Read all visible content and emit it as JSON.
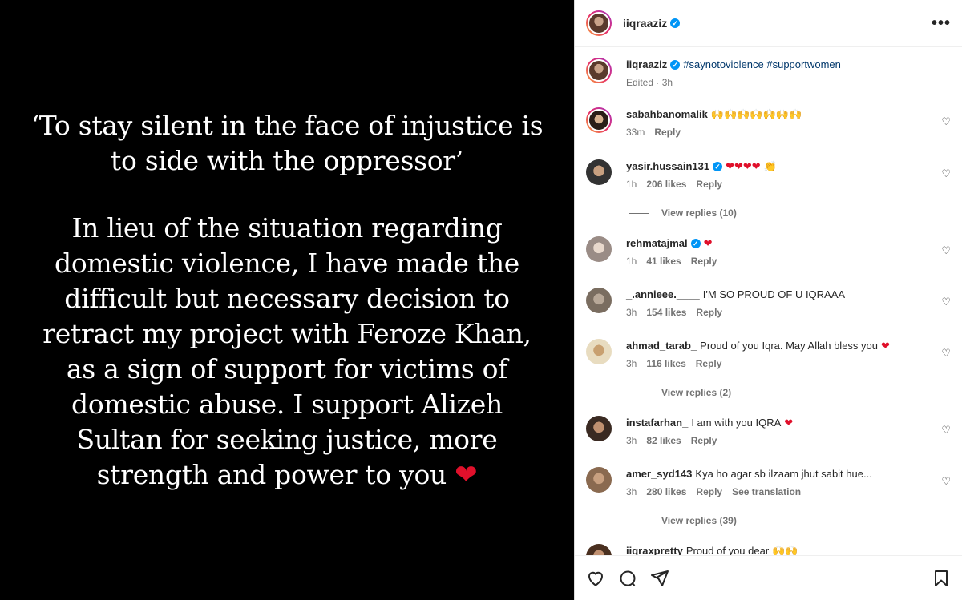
{
  "story": {
    "quote_lines": [
      "‘To stay silent in the face of injustice is",
      "to side with the oppressor’"
    ],
    "body_lines": [
      "In lieu of the situation regarding",
      "domestic violence, I have made the",
      "difficult but necessary decision to",
      "retract my project with Feroze Khan,",
      "as a sign of support for victims of",
      "domestic abuse. I support Alizeh",
      "Sultan for seeking justice, more",
      "strength and power to you"
    ],
    "heart": "❤"
  },
  "header": {
    "username": "iiqraaziz",
    "verified": "✓",
    "more": "•••"
  },
  "caption": {
    "username": "iiqraaziz",
    "text": "#saynotoviolence #supportwomen",
    "meta": "Edited · 3h"
  },
  "comments": [
    {
      "username": "sabahbanomalik",
      "text": "",
      "emoji": "🙌🙌🙌🙌🙌🙌🙌",
      "time": "33m",
      "likes": "",
      "reply": "Reply"
    },
    {
      "username": "yasir.hussain131",
      "verified": "✓",
      "text": "",
      "emoji": "❤❤❤❤",
      "emoji2": "👏",
      "time": "1h",
      "likes": "206 likes",
      "reply": "Reply",
      "view_replies": "View replies (10)"
    },
    {
      "username": "rehmatajmal",
      "verified": "✓",
      "text": "",
      "emoji": "❤",
      "time": "1h",
      "likes": "41 likes",
      "reply": "Reply"
    },
    {
      "username": "_.annieee.____",
      "text": "I'M SO PROUD OF U IQRAAA",
      "time": "3h",
      "likes": "154 likes",
      "reply": "Reply"
    },
    {
      "username": "ahmad_tarab_",
      "text": "Proud of you Iqra. May Allah bless you",
      "emoji": "❤",
      "time": "3h",
      "likes": "116 likes",
      "reply": "Reply",
      "view_replies": "View replies (2)"
    },
    {
      "username": "instafarhan_",
      "text": "I am with you IQRA",
      "emoji": "❤",
      "time": "3h",
      "likes": "82 likes",
      "reply": "Reply"
    },
    {
      "username": "amer_syd143",
      "text": "Kya ho agar sb ilzaam jhut sabit hue...",
      "time": "3h",
      "likes": "280 likes",
      "reply": "Reply",
      "see_translation": "See translation",
      "view_replies": "View replies (39)"
    },
    {
      "username": "iiqraxpretty",
      "text": "Proud of you dear",
      "emoji": "🙌🙌"
    }
  ],
  "icons": {
    "like": "heart-outline-icon",
    "comment": "comment-icon",
    "share": "send-icon",
    "save": "bookmark-icon",
    "comment_like": "small-heart-icon"
  },
  "colors": {
    "verified": "#0095f6",
    "hashtag": "#00376b",
    "heart": "#e0102b",
    "muted": "#737373"
  }
}
